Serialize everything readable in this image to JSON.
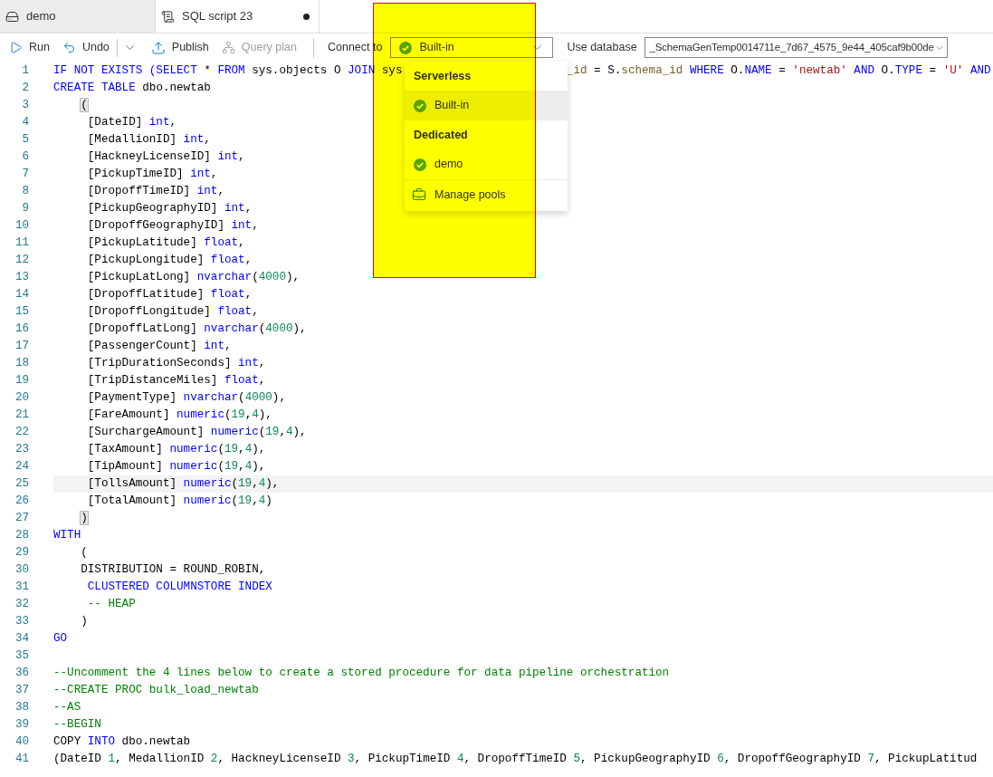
{
  "tabs": [
    {
      "label": "demo",
      "selected": false,
      "modified": false
    },
    {
      "label": "SQL script 23",
      "selected": true,
      "modified": true
    }
  ],
  "toolbar": {
    "buttons": [
      {
        "label": "Run",
        "disabled": false
      },
      {
        "label": "Undo",
        "disabled": false
      },
      {
        "label": "Publish",
        "disabled": false
      },
      {
        "label": "Query plan",
        "disabled": true
      }
    ],
    "connect_to": {
      "label": "Connect to",
      "value": "Built-in"
    },
    "use_database": {
      "label": "Use database",
      "value": "_SchemaGenTemp0014711e_7d67_4575_9e44_405caf9b00de"
    }
  },
  "dropdown": {
    "groups": [
      {
        "heading": "Serverless",
        "items": [
          {
            "label": "Built-in",
            "selected": true
          }
        ]
      },
      {
        "heading": "Dedicated",
        "items": [
          {
            "label": "demo",
            "selected": false
          }
        ]
      }
    ],
    "action": "Manage pools"
  },
  "editor": {
    "lines": [
      {
        "number": "1",
        "current": false,
        "segments": [
          [
            {
              "kind": "keyword",
              "text": "IF NOT EXISTS (SELECT"
            },
            {
              "kind": "plain",
              "text": " * "
            },
            {
              "kind": "keyword",
              "text": "FROM"
            },
            {
              "kind": "plain",
              "text": " sys.objects O "
            },
            {
              "kind": "keyword",
              "text": "JOIN"
            },
            {
              "kind": "plain",
              "text": " sys"
            }
          ],
          [
            {
              "kind": "function",
              "text": "_id"
            },
            {
              "kind": "plain",
              "text": " = S."
            },
            {
              "kind": "function",
              "text": "schema_id"
            },
            {
              "kind": "keyword",
              "text": " WHERE"
            },
            {
              "kind": "plain",
              "text": " O."
            },
            {
              "kind": "keyword",
              "text": "NAME"
            },
            {
              "kind": "plain",
              "text": " = "
            },
            {
              "kind": "string",
              "text": "'newtab'"
            },
            {
              "kind": "keyword",
              "text": " AND"
            },
            {
              "kind": "plain",
              "text": " O."
            },
            {
              "kind": "keyword",
              "text": "TYPE"
            },
            {
              "kind": "plain",
              "text": " = "
            },
            {
              "kind": "string",
              "text": "'U'"
            },
            {
              "kind": "keyword",
              "text": " AND"
            }
          ]
        ]
      },
      {
        "number": "2",
        "current": false,
        "segments": [
          [
            {
              "kind": "keyword",
              "text": "CREATE TABLE"
            },
            {
              "kind": "plain",
              "text": " dbo.newtab"
            }
          ]
        ]
      },
      {
        "number": "3",
        "current": false,
        "segments": [
          [
            {
              "kind": "match",
              "text": "    ("
            }
          ]
        ]
      },
      {
        "number": "4",
        "current": false,
        "segments": [
          [
            {
              "kind": "plain",
              "text": "     [DateID] "
            },
            {
              "kind": "keyword",
              "text": "int"
            },
            {
              "kind": "plain",
              "text": ","
            }
          ]
        ]
      },
      {
        "number": "5",
        "current": false,
        "segments": [
          [
            {
              "kind": "plain",
              "text": "     [MedallionID] "
            },
            {
              "kind": "keyword",
              "text": "int"
            },
            {
              "kind": "plain",
              "text": ","
            }
          ]
        ]
      },
      {
        "number": "6",
        "current": false,
        "segments": [
          [
            {
              "kind": "plain",
              "text": "     [HackneyLicenseID] "
            },
            {
              "kind": "keyword",
              "text": "int"
            },
            {
              "kind": "plain",
              "text": ","
            }
          ]
        ]
      },
      {
        "number": "7",
        "current": false,
        "segments": [
          [
            {
              "kind": "plain",
              "text": "     [PickupTimeID] "
            },
            {
              "kind": "keyword",
              "text": "int"
            },
            {
              "kind": "plain",
              "text": ","
            }
          ]
        ]
      },
      {
        "number": "8",
        "current": false,
        "segments": [
          [
            {
              "kind": "plain",
              "text": "     [DropoffTimeID] "
            },
            {
              "kind": "keyword",
              "text": "int"
            },
            {
              "kind": "plain",
              "text": ","
            }
          ]
        ]
      },
      {
        "number": "9",
        "current": false,
        "segments": [
          [
            {
              "kind": "plain",
              "text": "     [PickupGeographyID] "
            },
            {
              "kind": "keyword",
              "text": "int"
            },
            {
              "kind": "plain",
              "text": ","
            }
          ]
        ]
      },
      {
        "number": "10",
        "current": false,
        "segments": [
          [
            {
              "kind": "plain",
              "text": "     [DropoffGeographyID] "
            },
            {
              "kind": "keyword",
              "text": "int"
            },
            {
              "kind": "plain",
              "text": ","
            }
          ]
        ]
      },
      {
        "number": "11",
        "current": false,
        "segments": [
          [
            {
              "kind": "plain",
              "text": "     [PickupLatitude] "
            },
            {
              "kind": "keyword",
              "text": "float"
            },
            {
              "kind": "plain",
              "text": ","
            }
          ]
        ]
      },
      {
        "number": "12",
        "current": false,
        "segments": [
          [
            {
              "kind": "plain",
              "text": "     [PickupLongitude] "
            },
            {
              "kind": "keyword",
              "text": "float"
            },
            {
              "kind": "plain",
              "text": ","
            }
          ]
        ]
      },
      {
        "number": "13",
        "current": false,
        "segments": [
          [
            {
              "kind": "plain",
              "text": "     [PickupLatLong] "
            },
            {
              "kind": "keyword",
              "text": "nvarchar"
            },
            {
              "kind": "plain",
              "text": "("
            },
            {
              "kind": "number",
              "text": "4000"
            },
            {
              "kind": "plain",
              "text": "),"
            }
          ]
        ]
      },
      {
        "number": "14",
        "current": false,
        "segments": [
          [
            {
              "kind": "plain",
              "text": "     [DropoffLatitude] "
            },
            {
              "kind": "keyword",
              "text": "float"
            },
            {
              "kind": "plain",
              "text": ","
            }
          ]
        ]
      },
      {
        "number": "15",
        "current": false,
        "segments": [
          [
            {
              "kind": "plain",
              "text": "     [DropoffLongitude] "
            },
            {
              "kind": "keyword",
              "text": "float"
            },
            {
              "kind": "plain",
              "text": ","
            }
          ]
        ]
      },
      {
        "number": "16",
        "current": false,
        "segments": [
          [
            {
              "kind": "plain",
              "text": "     [DropoffLatLong] "
            },
            {
              "kind": "keyword",
              "text": "nvarchar"
            },
            {
              "kind": "plain",
              "text": "("
            },
            {
              "kind": "number",
              "text": "4000"
            },
            {
              "kind": "plain",
              "text": "),"
            }
          ]
        ]
      },
      {
        "number": "17",
        "current": false,
        "segments": [
          [
            {
              "kind": "plain",
              "text": "     [PassengerCount] "
            },
            {
              "kind": "keyword",
              "text": "int"
            },
            {
              "kind": "plain",
              "text": ","
            }
          ]
        ]
      },
      {
        "number": "18",
        "current": false,
        "segments": [
          [
            {
              "kind": "plain",
              "text": "     [TripDurationSeconds] "
            },
            {
              "kind": "keyword",
              "text": "int"
            },
            {
              "kind": "plain",
              "text": ","
            }
          ]
        ]
      },
      {
        "number": "19",
        "current": false,
        "segments": [
          [
            {
              "kind": "plain",
              "text": "     [TripDistanceMiles] "
            },
            {
              "kind": "keyword",
              "text": "float"
            },
            {
              "kind": "plain",
              "text": ","
            }
          ]
        ]
      },
      {
        "number": "20",
        "current": false,
        "segments": [
          [
            {
              "kind": "plain",
              "text": "     [PaymentType] "
            },
            {
              "kind": "keyword",
              "text": "nvarchar"
            },
            {
              "kind": "plain",
              "text": "("
            },
            {
              "kind": "number",
              "text": "4000"
            },
            {
              "kind": "plain",
              "text": "),"
            }
          ]
        ]
      },
      {
        "number": "21",
        "current": false,
        "segments": [
          [
            {
              "kind": "plain",
              "text": "     [FareAmount] "
            },
            {
              "kind": "keyword",
              "text": "numeric"
            },
            {
              "kind": "plain",
              "text": "("
            },
            {
              "kind": "number",
              "text": "19"
            },
            {
              "kind": "plain",
              "text": ","
            },
            {
              "kind": "number",
              "text": "4"
            },
            {
              "kind": "plain",
              "text": "),"
            }
          ]
        ]
      },
      {
        "number": "22",
        "current": false,
        "segments": [
          [
            {
              "kind": "plain",
              "text": "     [SurchargeAmount] "
            },
            {
              "kind": "keyword",
              "text": "numeric"
            },
            {
              "kind": "plain",
              "text": "("
            },
            {
              "kind": "number",
              "text": "19"
            },
            {
              "kind": "plain",
              "text": ","
            },
            {
              "kind": "number",
              "text": "4"
            },
            {
              "kind": "plain",
              "text": "),"
            }
          ]
        ]
      },
      {
        "number": "23",
        "current": false,
        "segments": [
          [
            {
              "kind": "plain",
              "text": "     [TaxAmount] "
            },
            {
              "kind": "keyword",
              "text": "numeric"
            },
            {
              "kind": "plain",
              "text": "("
            },
            {
              "kind": "number",
              "text": "19"
            },
            {
              "kind": "plain",
              "text": ","
            },
            {
              "kind": "number",
              "text": "4"
            },
            {
              "kind": "plain",
              "text": "),"
            }
          ]
        ]
      },
      {
        "number": "24",
        "current": false,
        "segments": [
          [
            {
              "kind": "plain",
              "text": "     [TipAmount] "
            },
            {
              "kind": "keyword",
              "text": "numeric"
            },
            {
              "kind": "plain",
              "text": "("
            },
            {
              "kind": "number",
              "text": "19"
            },
            {
              "kind": "plain",
              "text": ","
            },
            {
              "kind": "number",
              "text": "4"
            },
            {
              "kind": "plain",
              "text": "),"
            }
          ]
        ]
      },
      {
        "number": "25",
        "current": true,
        "segments": [
          [
            {
              "kind": "plain",
              "text": "     [TollsAmount] "
            },
            {
              "kind": "keyword",
              "text": "numeric"
            },
            {
              "kind": "plain",
              "text": "("
            },
            {
              "kind": "number",
              "text": "19"
            },
            {
              "kind": "plain",
              "text": ","
            },
            {
              "kind": "number",
              "text": "4"
            },
            {
              "kind": "plain",
              "text": "),"
            }
          ]
        ]
      },
      {
        "number": "26",
        "current": false,
        "segments": [
          [
            {
              "kind": "plain",
              "text": "     [TotalAmount] "
            },
            {
              "kind": "keyword",
              "text": "numeric"
            },
            {
              "kind": "plain",
              "text": "("
            },
            {
              "kind": "number",
              "text": "19"
            },
            {
              "kind": "plain",
              "text": ","
            },
            {
              "kind": "number",
              "text": "4"
            },
            {
              "kind": "plain",
              "text": ")"
            }
          ]
        ]
      },
      {
        "number": "27",
        "current": false,
        "segments": [
          [
            {
              "kind": "match",
              "text": "    )"
            }
          ]
        ]
      },
      {
        "number": "28",
        "current": false,
        "segments": [
          [
            {
              "kind": "keyword",
              "text": "WITH"
            }
          ]
        ]
      },
      {
        "number": "29",
        "current": false,
        "segments": [
          [
            {
              "kind": "plain",
              "text": "    ("
            }
          ]
        ]
      },
      {
        "number": "30",
        "current": false,
        "segments": [
          [
            {
              "kind": "plain",
              "text": "    DISTRIBUTION = ROUND_ROBIN,"
            }
          ]
        ]
      },
      {
        "number": "31",
        "current": false,
        "segments": [
          [
            {
              "kind": "keyword",
              "text": "     CLUSTERED COLUMNSTORE INDEX"
            }
          ]
        ]
      },
      {
        "number": "32",
        "current": false,
        "segments": [
          [
            {
              "kind": "comment",
              "text": "     -- HEAP"
            }
          ]
        ]
      },
      {
        "number": "33",
        "current": false,
        "segments": [
          [
            {
              "kind": "plain",
              "text": "    )"
            }
          ]
        ]
      },
      {
        "number": "34",
        "current": false,
        "segments": [
          [
            {
              "kind": "keyword",
              "text": "GO"
            }
          ]
        ]
      },
      {
        "number": "35",
        "current": false
      },
      {
        "number": "36",
        "current": false,
        "segments": [
          [
            {
              "kind": "comment",
              "text": "--Uncomment the 4 lines below to create a stored procedure for data pipeline orchestration"
            }
          ]
        ]
      },
      {
        "number": "37",
        "current": false,
        "segments": [
          [
            {
              "kind": "comment",
              "text": "--CREATE PROC bulk_load_newtab"
            }
          ]
        ]
      },
      {
        "number": "38",
        "current": false,
        "segments": [
          [
            {
              "kind": "comment",
              "text": "--AS"
            }
          ]
        ]
      },
      {
        "number": "39",
        "current": false,
        "segments": [
          [
            {
              "kind": "comment",
              "text": "--BEGIN"
            }
          ]
        ]
      },
      {
        "number": "40",
        "current": false,
        "segments": [
          [
            {
              "kind": "plain",
              "text": "COPY "
            },
            {
              "kind": "keyword",
              "text": "INTO"
            },
            {
              "kind": "plain",
              "text": " dbo.newtab"
            }
          ]
        ]
      },
      {
        "number": "41",
        "current": false,
        "segments": [
          [
            {
              "kind": "plain",
              "text": "(DateID "
            },
            {
              "kind": "number",
              "text": "1"
            },
            {
              "kind": "plain",
              "text": ", MedallionID "
            },
            {
              "kind": "number",
              "text": "2"
            },
            {
              "kind": "plain",
              "text": ", HackneyLicenseID "
            },
            {
              "kind": "number",
              "text": "3"
            },
            {
              "kind": "plain",
              "text": ", PickupTimeID "
            },
            {
              "kind": "number",
              "text": "4"
            },
            {
              "kind": "plain",
              "text": ", DropoffTimeID "
            },
            {
              "kind": "number",
              "text": "5"
            },
            {
              "kind": "plain",
              "text": ", PickupGeographyID "
            },
            {
              "kind": "number",
              "text": "6"
            },
            {
              "kind": "plain",
              "text": ", DropoffGeographyID "
            },
            {
              "kind": "number",
              "text": "7"
            },
            {
              "kind": "plain",
              "text": ", PickupLatitud"
            }
          ]
        ]
      }
    ]
  }
}
